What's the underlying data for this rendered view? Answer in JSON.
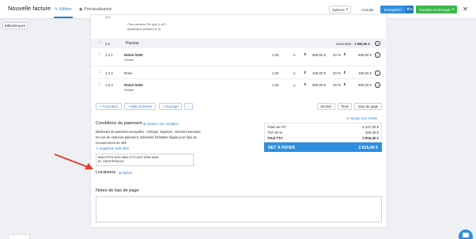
{
  "header": {
    "title": "Nouvelle facture",
    "tabs": [
      {
        "label": "Edition",
        "active": true
      },
      {
        "label": "Prévisualisation",
        "active": false
      }
    ],
    "options_label": "Options",
    "cancel_label": "Annuler",
    "save_label": "Enregistrer",
    "save_shortcut": "⌘S",
    "finalize_label": "Finaliser et envoyer",
    "close_label": "✕"
  },
  "sidebar": {
    "libraries_label": "Bibliothèques"
  },
  "prev_item": {
    "number": "1.1.",
    "detail_lines": [
      "- Pour peinture 20L gris (1 m²)",
      "- Application peinture (1 h)"
    ]
  },
  "section": {
    "number": "1.2",
    "title": "Piscine",
    "subtotal_label": "Sous-total :",
    "subtotal_value": "1 900,00 €"
  },
  "items": [
    {
      "number": "1.2.1",
      "name": "Robot 5200",
      "detail": "Détails",
      "qty": "1,00",
      "unit": "u",
      "price": "900,00 €",
      "vat": "20 %",
      "total": "900,00 €"
    },
    {
      "number": "1.2.2",
      "name": "Robo",
      "detail": "",
      "qty": "1,00",
      "unit": "u",
      "price": "100,00 €",
      "vat": "20 %",
      "total": "100,00 €"
    },
    {
      "number": "1.2.3",
      "name": "Robot 5200",
      "detail": "Détails",
      "qty": "1,00",
      "unit": "u",
      "price": "900,00 €",
      "vat": "20 %",
      "total": "900,00 €"
    }
  ],
  "add_buttons": [
    "+ Fourniture",
    "+ Main d'oeuvre",
    "+ Ouvrage",
    "..."
  ],
  "insert_buttons": [
    "Section",
    "Texte",
    "Saut de page"
  ],
  "payment": {
    "title": "Conditions de paiement",
    "add_link": "Ajouter une condition",
    "lines": [
      "Méthodes de paiement acceptées : Chèque, Espèces, Virement bancaire",
      "En cas de retard de paiement, indemnité forfaitaire légale pour frais de",
      "recouvrement de 40€."
    ],
    "remove_link": "Supprimer texte libre",
    "iban": "IBAN FR76 3004 3663 4772 8427 8992 4628",
    "bic": "BI: CMCIFR1NXXX"
  },
  "delivery": {
    "title": "Livraisons",
    "link": "Définir"
  },
  "discount_link": "Ajouter une remise",
  "totals": {
    "rows": [
      {
        "label": "Total net HT",
        "value": "2 347,00 €"
      },
      {
        "label": "TVA 20 %",
        "value": "469,40 €"
      },
      {
        "label": "Total TTC",
        "value": "2 816,40 €"
      }
    ],
    "pay_label": "NET À PAYER",
    "pay_value": "2 816,40 €"
  },
  "footer": {
    "title": "Notes de bas de page"
  },
  "colors": {
    "accent": "#2e8fe0",
    "success": "#3cb54a",
    "annotation": "#e53b2c"
  }
}
